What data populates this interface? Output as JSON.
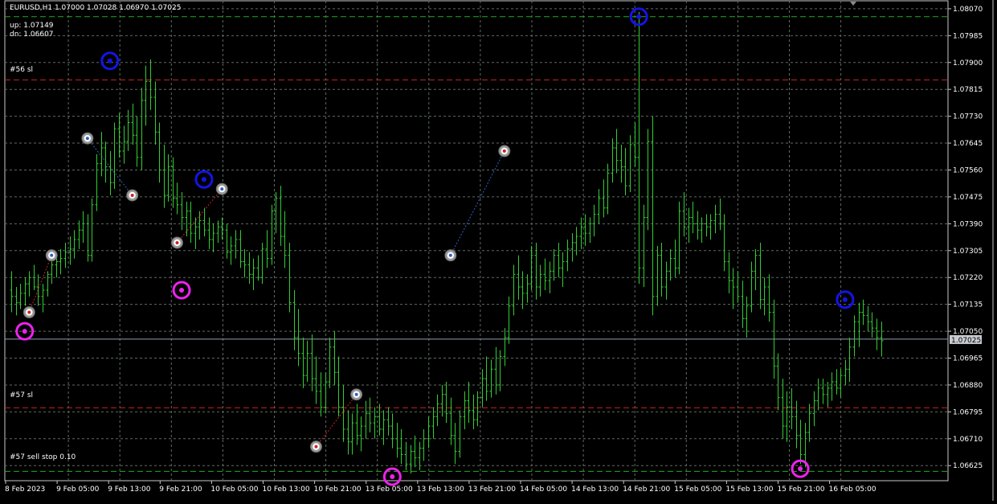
{
  "header": {
    "title_line": "EURUSD,H1  1.07000 1.07028 1.06970 1.07025",
    "up_text": "up: 1.07149",
    "dn_text": "dn: 1.06607"
  },
  "colors": {
    "background": "#000000",
    "grid": "#5f6b5f",
    "candle": "#32cd32",
    "sl_line": "#cc2222",
    "tp_line": "#22aa22",
    "bid_line": "#8aa0b4",
    "swing_high": "#1414e6",
    "swing_low": "#ee22ee",
    "label_text": "#ffffff"
  },
  "levels": {
    "sl56": {
      "label": "#56 sl",
      "price": 1.07845
    },
    "sl57": {
      "label": "#57 sl",
      "price": 1.06808
    },
    "sellstop57": {
      "label": "#57 sell stop 0.10",
      "price": 1.06607
    },
    "top_tp": {
      "price": 1.08045
    },
    "bid": {
      "price": 1.07025,
      "label": "1.07025"
    }
  },
  "price_axis": {
    "labels": [
      "1.08070",
      "1.07985",
      "1.07900",
      "1.07815",
      "1.07730",
      "1.07645",
      "1.07560",
      "1.07475",
      "1.07390",
      "1.07305",
      "1.07220",
      "1.07135",
      "1.07050",
      "1.06965",
      "1.06880",
      "1.06795",
      "1.06710",
      "1.06625"
    ]
  },
  "time_axis": {
    "labels": [
      "8 Feb 2023",
      "9 Feb 05:00",
      "9 Feb 13:00",
      "9 Feb 21:00",
      "10 Feb 05:00",
      "10 Feb 13:00",
      "10 Feb 21:00",
      "13 Feb 05:00",
      "13 Feb 13:00",
      "13 Feb 21:00",
      "14 Feb 05:00",
      "14 Feb 13:00",
      "14 Feb 21:00",
      "15 Feb 05:00",
      "15 Feb 13:00",
      "15 Feb 21:00",
      "16 Feb 05:00"
    ]
  },
  "chart_data": {
    "type": "candlestick-bars",
    "symbol": "EURUSD",
    "timeframe": "H1",
    "ylim": [
      1.0659,
      1.08085
    ],
    "candles": [
      [
        1.0718,
        1.0724,
        1.0711,
        1.0716
      ],
      [
        1.0716,
        1.0719,
        1.071,
        1.0714
      ],
      [
        1.0714,
        1.072,
        1.0712,
        1.0717
      ],
      [
        1.0717,
        1.0722,
        1.0713,
        1.072
      ],
      [
        1.072,
        1.0724,
        1.0716,
        1.0722
      ],
      [
        1.0722,
        1.0726,
        1.0718,
        1.0719
      ],
      [
        1.0719,
        1.0723,
        1.0713,
        1.0716
      ],
      [
        1.0716,
        1.072,
        1.0711,
        1.0718
      ],
      [
        1.0718,
        1.0724,
        1.0716,
        1.0723
      ],
      [
        1.0723,
        1.0728,
        1.072,
        1.0726
      ],
      [
        1.0726,
        1.073,
        1.0722,
        1.0727
      ],
      [
        1.0727,
        1.0731,
        1.0723,
        1.0728
      ],
      [
        1.0728,
        1.0733,
        1.0725,
        1.073
      ],
      [
        1.073,
        1.0735,
        1.0726,
        1.0731
      ],
      [
        1.0731,
        1.0737,
        1.0728,
        1.0734
      ],
      [
        1.0734,
        1.074,
        1.0731,
        1.0737
      ],
      [
        1.0737,
        1.0743,
        1.0733,
        1.0739
      ],
      [
        1.0739,
        1.0742,
        1.0727,
        1.0729
      ],
      [
        1.0729,
        1.0747,
        1.0727,
        1.0745
      ],
      [
        1.0745,
        1.0761,
        1.0743,
        1.0758
      ],
      [
        1.0758,
        1.0768,
        1.0754,
        1.0763
      ],
      [
        1.0763,
        1.0765,
        1.0752,
        1.0757
      ],
      [
        1.0757,
        1.0762,
        1.0748,
        1.0752
      ],
      [
        1.0752,
        1.0771,
        1.075,
        1.0769
      ],
      [
        1.0769,
        1.0774,
        1.076,
        1.0762
      ],
      [
        1.0762,
        1.077,
        1.0758,
        1.0765
      ],
      [
        1.0765,
        1.0775,
        1.0762,
        1.0771
      ],
      [
        1.0771,
        1.0777,
        1.0764,
        1.0767
      ],
      [
        1.0767,
        1.0773,
        1.0757,
        1.076
      ],
      [
        1.076,
        1.0782,
        1.0756,
        1.0778
      ],
      [
        1.0778,
        1.0789,
        1.077,
        1.0784
      ],
      [
        1.0784,
        1.0791,
        1.0775,
        1.0779
      ],
      [
        1.0779,
        1.0784,
        1.0764,
        1.0768
      ],
      [
        1.0768,
        1.0771,
        1.0752,
        1.0756
      ],
      [
        1.0756,
        1.0764,
        1.0744,
        1.0748
      ],
      [
        1.0748,
        1.0761,
        1.0746,
        1.0757
      ],
      [
        1.0757,
        1.076,
        1.0744,
        1.0747
      ],
      [
        1.0747,
        1.0752,
        1.0742,
        1.0745
      ],
      [
        1.0745,
        1.0749,
        1.0737,
        1.0741
      ],
      [
        1.0741,
        1.0746,
        1.0735,
        1.0743
      ],
      [
        1.0743,
        1.0746,
        1.0733,
        1.0736
      ],
      [
        1.0736,
        1.0741,
        1.0731,
        1.0738
      ],
      [
        1.0738,
        1.0743,
        1.0734,
        1.074
      ],
      [
        1.074,
        1.0744,
        1.0735,
        1.0737
      ],
      [
        1.0737,
        1.0741,
        1.0731,
        1.0734
      ],
      [
        1.0734,
        1.0739,
        1.073,
        1.0736
      ],
      [
        1.0736,
        1.074,
        1.0733,
        1.0738
      ],
      [
        1.0738,
        1.0741,
        1.0734,
        1.0737
      ],
      [
        1.0737,
        1.0739,
        1.0728,
        1.073
      ],
      [
        1.073,
        1.0735,
        1.0726,
        1.0732
      ],
      [
        1.0732,
        1.0737,
        1.0728,
        1.0734
      ],
      [
        1.0734,
        1.0737,
        1.0725,
        1.0727
      ],
      [
        1.0727,
        1.0731,
        1.0722,
        1.0726
      ],
      [
        1.0726,
        1.073,
        1.072,
        1.0723
      ],
      [
        1.0723,
        1.0728,
        1.0718,
        1.0725
      ],
      [
        1.0725,
        1.0729,
        1.0721,
        1.0722
      ],
      [
        1.0722,
        1.0733,
        1.072,
        1.0731
      ],
      [
        1.0731,
        1.0737,
        1.0725,
        1.0728
      ],
      [
        1.0728,
        1.0745,
        1.0726,
        1.0743
      ],
      [
        1.0743,
        1.0749,
        1.0736,
        1.0747
      ],
      [
        1.0747,
        1.0751,
        1.0732,
        1.0735
      ],
      [
        1.0735,
        1.0743,
        1.0725,
        1.0729
      ],
      [
        1.0729,
        1.0733,
        1.0711,
        1.0714
      ],
      [
        1.0714,
        1.0718,
        1.0699,
        1.0703
      ],
      [
        1.0703,
        1.0712,
        1.0694,
        1.0698
      ],
      [
        1.0698,
        1.0703,
        1.0687,
        1.0691
      ],
      [
        1.0691,
        1.0702,
        1.0689,
        1.0698
      ],
      [
        1.0698,
        1.0704,
        1.0686,
        1.069
      ],
      [
        1.069,
        1.0697,
        1.0682,
        1.0686
      ],
      [
        1.0686,
        1.0692,
        1.0678,
        1.0681
      ],
      [
        1.0681,
        1.0692,
        1.0679,
        1.0689
      ],
      [
        1.0689,
        1.0703,
        1.0687,
        1.07
      ],
      [
        1.07,
        1.0705,
        1.0688,
        1.0692
      ],
      [
        1.0692,
        1.0697,
        1.0678,
        1.0681
      ],
      [
        1.0681,
        1.0688,
        1.067,
        1.0674
      ],
      [
        1.0674,
        1.068,
        1.0666,
        1.067
      ],
      [
        1.067,
        1.0679,
        1.0666,
        1.0676
      ],
      [
        1.0676,
        1.0682,
        1.0669,
        1.0672
      ],
      [
        1.0672,
        1.0678,
        1.0667,
        1.0675
      ],
      [
        1.0675,
        1.0683,
        1.0671,
        1.0679
      ],
      [
        1.0679,
        1.0684,
        1.0673,
        1.0676
      ],
      [
        1.0676,
        1.0681,
        1.0671,
        1.0678
      ],
      [
        1.0678,
        1.0682,
        1.0672,
        1.0674
      ],
      [
        1.0674,
        1.068,
        1.0669,
        1.0677
      ],
      [
        1.0677,
        1.0681,
        1.0672,
        1.0675
      ],
      [
        1.0675,
        1.0679,
        1.0668,
        1.0671
      ],
      [
        1.0671,
        1.0676,
        1.0665,
        1.0668
      ],
      [
        1.0668,
        1.0674,
        1.0663,
        1.0666
      ],
      [
        1.0666,
        1.067,
        1.0661,
        1.0663
      ],
      [
        1.0663,
        1.0669,
        1.066,
        1.0667
      ],
      [
        1.0667,
        1.0672,
        1.0662,
        1.0665
      ],
      [
        1.0665,
        1.067,
        1.0661,
        1.0668
      ],
      [
        1.0668,
        1.0674,
        1.0664,
        1.0671
      ],
      [
        1.0671,
        1.0678,
        1.0668,
        1.0675
      ],
      [
        1.0675,
        1.0681,
        1.0671,
        1.0678
      ],
      [
        1.0678,
        1.0685,
        1.0675,
        1.0682
      ],
      [
        1.0682,
        1.0688,
        1.0678,
        1.0685
      ],
      [
        1.0685,
        1.0689,
        1.0676,
        1.0679
      ],
      [
        1.0679,
        1.0684,
        1.0669,
        1.0672
      ],
      [
        1.0672,
        1.0676,
        1.0663,
        1.0667
      ],
      [
        1.0667,
        1.068,
        1.0665,
        1.0678
      ],
      [
        1.0678,
        1.0686,
        1.0674,
        1.0683
      ],
      [
        1.0683,
        1.0689,
        1.0676,
        1.068
      ],
      [
        1.068,
        1.0685,
        1.0674,
        1.0677
      ],
      [
        1.0677,
        1.0686,
        1.0675,
        1.0684
      ],
      [
        1.0684,
        1.0693,
        1.0681,
        1.069
      ],
      [
        1.069,
        1.0697,
        1.0683,
        1.0686
      ],
      [
        1.0686,
        1.0696,
        1.0684,
        1.0693
      ],
      [
        1.0693,
        1.07,
        1.0685,
        1.0688
      ],
      [
        1.0688,
        1.0699,
        1.0686,
        1.0697
      ],
      [
        1.0697,
        1.0706,
        1.0694,
        1.0703
      ],
      [
        1.0703,
        1.0716,
        1.0701,
        1.0713
      ],
      [
        1.0713,
        1.0726,
        1.071,
        1.0723
      ],
      [
        1.0723,
        1.0729,
        1.0715,
        1.0719
      ],
      [
        1.0719,
        1.0724,
        1.0712,
        1.0717
      ],
      [
        1.0717,
        1.0723,
        1.0714,
        1.072
      ],
      [
        1.072,
        1.0732,
        1.0718,
        1.0729
      ],
      [
        1.0729,
        1.0733,
        1.0715,
        1.0719
      ],
      [
        1.0719,
        1.0726,
        1.0716,
        1.0723
      ],
      [
        1.0723,
        1.0728,
        1.0718,
        1.0721
      ],
      [
        1.0721,
        1.0727,
        1.0717,
        1.0724
      ],
      [
        1.0724,
        1.0731,
        1.0721,
        1.0729
      ],
      [
        1.0729,
        1.0733,
        1.0722,
        1.0725
      ],
      [
        1.0725,
        1.073,
        1.0719,
        1.0727
      ],
      [
        1.0727,
        1.0734,
        1.0724,
        1.0731
      ],
      [
        1.0731,
        1.0736,
        1.0727,
        1.0733
      ],
      [
        1.0733,
        1.0738,
        1.0729,
        1.0735
      ],
      [
        1.0735,
        1.0741,
        1.0731,
        1.0738
      ],
      [
        1.0738,
        1.0742,
        1.0732,
        1.0736
      ],
      [
        1.0736,
        1.0741,
        1.0733,
        1.0739
      ],
      [
        1.0739,
        1.0745,
        1.0735,
        1.0742
      ],
      [
        1.0742,
        1.075,
        1.0739,
        1.0747
      ],
      [
        1.0747,
        1.0753,
        1.0741,
        1.0744
      ],
      [
        1.0744,
        1.0758,
        1.0742,
        1.0755
      ],
      [
        1.0755,
        1.0766,
        1.0752,
        1.0763
      ],
      [
        1.0763,
        1.0769,
        1.0755,
        1.0759
      ],
      [
        1.0759,
        1.0764,
        1.0752,
        1.0757
      ],
      [
        1.0757,
        1.0763,
        1.0748,
        1.0751
      ],
      [
        1.0751,
        1.0767,
        1.0749,
        1.0764
      ],
      [
        1.0764,
        1.0771,
        1.0757,
        1.076
      ],
      [
        1.076,
        1.0806,
        1.072,
        1.0725
      ],
      [
        1.0725,
        1.0745,
        1.0719,
        1.0741
      ],
      [
        1.0741,
        1.0769,
        1.0737,
        1.0765
      ],
      [
        1.0765,
        1.0773,
        1.071,
        1.0716
      ],
      [
        1.0716,
        1.0732,
        1.0713,
        1.0729
      ],
      [
        1.0729,
        1.0733,
        1.0716,
        1.0719
      ],
      [
        1.0719,
        1.0727,
        1.0715,
        1.0724
      ],
      [
        1.0724,
        1.0731,
        1.0721,
        1.0728
      ],
      [
        1.0728,
        1.0734,
        1.0722,
        1.0725
      ],
      [
        1.0725,
        1.0746,
        1.0723,
        1.0743
      ],
      [
        1.0743,
        1.0749,
        1.0735,
        1.0738
      ],
      [
        1.0738,
        1.0744,
        1.0733,
        1.0741
      ],
      [
        1.0741,
        1.0746,
        1.0736,
        1.0739
      ],
      [
        1.0739,
        1.0743,
        1.0734,
        1.0737
      ],
      [
        1.0737,
        1.0741,
        1.0733,
        1.0739
      ],
      [
        1.0739,
        1.0742,
        1.0735,
        1.0738
      ],
      [
        1.0738,
        1.0742,
        1.0734,
        1.074
      ],
      [
        1.074,
        1.0745,
        1.0736,
        1.0742
      ],
      [
        1.0742,
        1.0747,
        1.0737,
        1.0739
      ],
      [
        1.0739,
        1.0742,
        1.0724,
        1.0727
      ],
      [
        1.0727,
        1.073,
        1.0717,
        1.0721
      ],
      [
        1.0721,
        1.0725,
        1.0712,
        1.0719
      ],
      [
        1.0719,
        1.0724,
        1.0714,
        1.0716
      ],
      [
        1.0716,
        1.0721,
        1.0706,
        1.0709
      ],
      [
        1.0709,
        1.0716,
        1.0703,
        1.0713
      ],
      [
        1.0713,
        1.0727,
        1.0711,
        1.0724
      ],
      [
        1.0724,
        1.0731,
        1.0718,
        1.0729
      ],
      [
        1.0729,
        1.0733,
        1.0712,
        1.0715
      ],
      [
        1.0715,
        1.0722,
        1.071,
        1.0719
      ],
      [
        1.0719,
        1.0723,
        1.0708,
        1.0711
      ],
      [
        1.0711,
        1.0715,
        1.069,
        1.0694
      ],
      [
        1.0694,
        1.0698,
        1.068,
        1.0684
      ],
      [
        1.0684,
        1.069,
        1.0671,
        1.0675
      ],
      [
        1.0675,
        1.0686,
        1.067,
        1.0681
      ],
      [
        1.0681,
        1.0687,
        1.0674,
        1.0678
      ],
      [
        1.0678,
        1.0683,
        1.0668,
        1.0672
      ],
      [
        1.0672,
        1.0677,
        1.0663,
        1.0666
      ],
      [
        1.0666,
        1.0676,
        1.0662,
        1.0673
      ],
      [
        1.0673,
        1.0682,
        1.067,
        1.0679
      ],
      [
        1.0679,
        1.0686,
        1.0675,
        1.0683
      ],
      [
        1.0683,
        1.069,
        1.068,
        1.0687
      ],
      [
        1.0687,
        1.069,
        1.0682,
        1.0685
      ],
      [
        1.0685,
        1.0689,
        1.0681,
        1.0687
      ],
      [
        1.0687,
        1.0692,
        1.0683,
        1.0689
      ],
      [
        1.0689,
        1.0693,
        1.0685,
        1.0687
      ],
      [
        1.0687,
        1.0693,
        1.0684,
        1.0691
      ],
      [
        1.0691,
        1.0696,
        1.0688,
        1.0693
      ],
      [
        1.0693,
        1.0703,
        1.0689,
        1.07
      ],
      [
        1.07,
        1.071,
        1.0697,
        1.0708
      ],
      [
        1.0708,
        1.0714,
        1.07,
        1.0711
      ],
      [
        1.0711,
        1.0715,
        1.0707,
        1.071
      ],
      [
        1.071,
        1.0713,
        1.0705,
        1.0708
      ],
      [
        1.0708,
        1.0711,
        1.0703,
        1.0706
      ],
      [
        1.0706,
        1.0709,
        1.0699,
        1.0703
      ],
      [
        1.0703,
        1.0708,
        1.0697,
        1.0702
      ]
    ],
    "swing_highs": [
      {
        "bar": 22,
        "price": 1.07905
      },
      {
        "bar": 43,
        "price": 1.0753
      },
      {
        "bar": 140,
        "price": 1.08045
      },
      {
        "bar": 186,
        "price": 1.0715
      }
    ],
    "swing_lows": [
      {
        "bar": 3,
        "price": 1.0705
      },
      {
        "bar": 38,
        "price": 1.0718
      },
      {
        "bar": 85,
        "price": 1.0659
      },
      {
        "bar": 176,
        "price": 1.06615
      }
    ],
    "trade_markers": [
      {
        "bar": 4,
        "price": 1.0711,
        "kind": "sell-entry"
      },
      {
        "bar": 9,
        "price": 1.0729,
        "kind": "buy-entry"
      },
      {
        "bar": 17,
        "price": 1.0766,
        "kind": "buy-entry"
      },
      {
        "bar": 27,
        "price": 1.0748,
        "kind": "sell-entry"
      },
      {
        "bar": 37,
        "price": 1.0733,
        "kind": "sell-entry"
      },
      {
        "bar": 47,
        "price": 1.075,
        "kind": "buy-entry"
      },
      {
        "bar": 68,
        "price": 1.06685,
        "kind": "sell-entry"
      },
      {
        "bar": 77,
        "price": 1.0685,
        "kind": "buy-entry"
      },
      {
        "bar": 98,
        "price": 1.0729,
        "kind": "buy-entry"
      },
      {
        "bar": 110,
        "price": 1.0762,
        "kind": "sell-entry"
      }
    ],
    "trade_links": [
      {
        "from": 0,
        "to": 1,
        "color": "#cc2222"
      },
      {
        "from": 2,
        "to": 3,
        "color": "#3060c0"
      },
      {
        "from": 4,
        "to": 5,
        "color": "#cc2222"
      },
      {
        "from": 6,
        "to": 7,
        "color": "#cc2222"
      },
      {
        "from": 8,
        "to": 9,
        "color": "#3060c0"
      }
    ]
  }
}
